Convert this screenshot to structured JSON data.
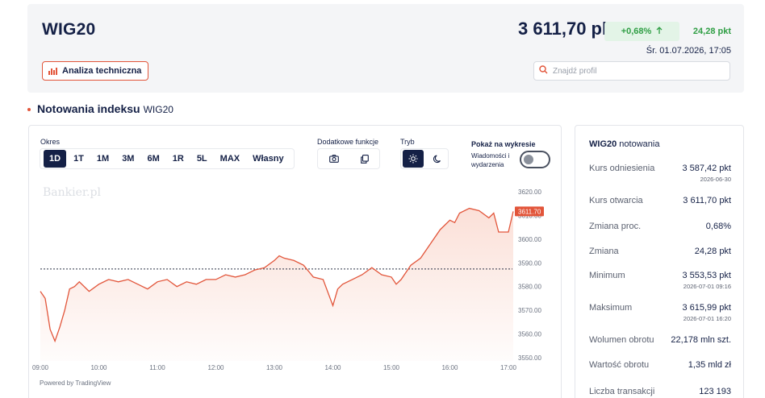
{
  "header": {
    "symbol": "WIG20",
    "technical_button": "Analiza techniczna",
    "price": "3 611,70 pkt",
    "change_pct": "+0,68%",
    "change_abs": "24,28 pkt",
    "datetime": "Śr. 01.07.2026, 17:05",
    "search_placeholder": "Znajdź profil",
    "icons": {
      "technical": "bar-chart-icon",
      "change": "arrow-up-icon",
      "search": "search-icon"
    },
    "colors": {
      "accent": "#e2553a",
      "positive": "#2f9e44",
      "navy": "#142046"
    }
  },
  "section": {
    "title": "Notowania indeksu",
    "subtitle": "WIG20"
  },
  "chart_panel": {
    "okres_label": "Okres",
    "ranges": [
      "1D",
      "1T",
      "1M",
      "3M",
      "6M",
      "1R",
      "5L",
      "MAX",
      "Własny"
    ],
    "active_range": "1D",
    "extra_label": "Dodatkowe funkcje",
    "extra_icons": [
      "camera-icon",
      "copy-icon"
    ],
    "mode_label": "Tryb",
    "mode_icons": [
      "sun-icon",
      "moon-icon"
    ],
    "show_label": "Pokaż na wykresie",
    "show_sub": "Wiadomości i wydarzenia",
    "show_toggle_on": false,
    "watermark": "Bankier.pl",
    "powered": "Powered by TradingView"
  },
  "chart_data": {
    "type": "area",
    "x_tick_labels": [
      "09:00",
      "10:00",
      "11:00",
      "12:00",
      "13:00",
      "14:00",
      "15:00",
      "16:00",
      "17:00"
    ],
    "y_tick_labels": [
      "3620.00",
      "3610.00",
      "3600.00",
      "3590.00",
      "3580.00",
      "3570.00",
      "3560.00",
      "3550.00"
    ],
    "ylim": [
      3550,
      3620
    ],
    "xlim": [
      "09:00",
      "17:05"
    ],
    "reference_line": 3587.42,
    "last_value_label": "3611.70",
    "series": [
      {
        "line_color": "#e2553a",
        "x": [
          "09:00",
          "09:05",
          "09:10",
          "09:15",
          "09:20",
          "09:25",
          "09:30",
          "09:35",
          "09:40",
          "09:50",
          "10:00",
          "10:10",
          "10:20",
          "10:30",
          "10:40",
          "10:50",
          "11:00",
          "11:10",
          "11:20",
          "11:30",
          "11:40",
          "11:50",
          "12:00",
          "12:10",
          "12:20",
          "12:30",
          "12:40",
          "12:50",
          "13:00",
          "13:05",
          "13:10",
          "13:20",
          "13:30",
          "13:40",
          "13:50",
          "14:00",
          "14:05",
          "14:10",
          "14:20",
          "14:30",
          "14:40",
          "14:50",
          "15:00",
          "15:05",
          "15:10",
          "15:20",
          "15:30",
          "15:40",
          "15:50",
          "16:00",
          "16:05",
          "16:10",
          "16:20",
          "16:30",
          "16:40",
          "16:45",
          "16:50",
          "17:00",
          "17:05"
        ],
        "y": [
          3578,
          3575,
          3562,
          3557,
          3563,
          3570,
          3579,
          3580,
          3582,
          3578,
          3581,
          3583,
          3582,
          3583,
          3581,
          3579,
          3582,
          3583,
          3580,
          3582,
          3581,
          3583,
          3583,
          3585,
          3584,
          3585,
          3587,
          3588,
          3591,
          3593,
          3592,
          3591,
          3589,
          3584,
          3583,
          3572,
          3579,
          3581,
          3583,
          3585,
          3588,
          3585,
          3584,
          3581,
          3583,
          3589,
          3592,
          3598,
          3604,
          3608,
          3607,
          3611,
          3613,
          3612,
          3609,
          3611,
          3603,
          3603,
          3611.7
        ]
      }
    ]
  },
  "quotes": {
    "title_symbol": "WIG20",
    "title_text": "notowania",
    "rows": [
      {
        "label": "Kurs odniesienia",
        "value": "3 587,42 pkt",
        "sub": "2026-06-30"
      },
      {
        "label": "Kurs otwarcia",
        "value": "3 611,70 pkt",
        "sub": ""
      },
      {
        "label": "Zmiana proc.",
        "value": "0,68%",
        "sub": ""
      },
      {
        "label": "Zmiana",
        "value": "24,28 pkt",
        "sub": ""
      },
      {
        "label": "Minimum",
        "value": "3 553,53 pkt",
        "sub": "2026-07-01 09:16"
      },
      {
        "label": "Maksimum",
        "value": "3 615,99 pkt",
        "sub": "2026-07-01 16:20"
      },
      {
        "label": "Wolumen obrotu",
        "value": "22,178 mln szt.",
        "sub": ""
      },
      {
        "label": "Wartość obrotu",
        "value": "1,35 mld zł",
        "sub": ""
      },
      {
        "label": "Liczba transakcji",
        "value": "123 193",
        "sub": ""
      }
    ]
  }
}
